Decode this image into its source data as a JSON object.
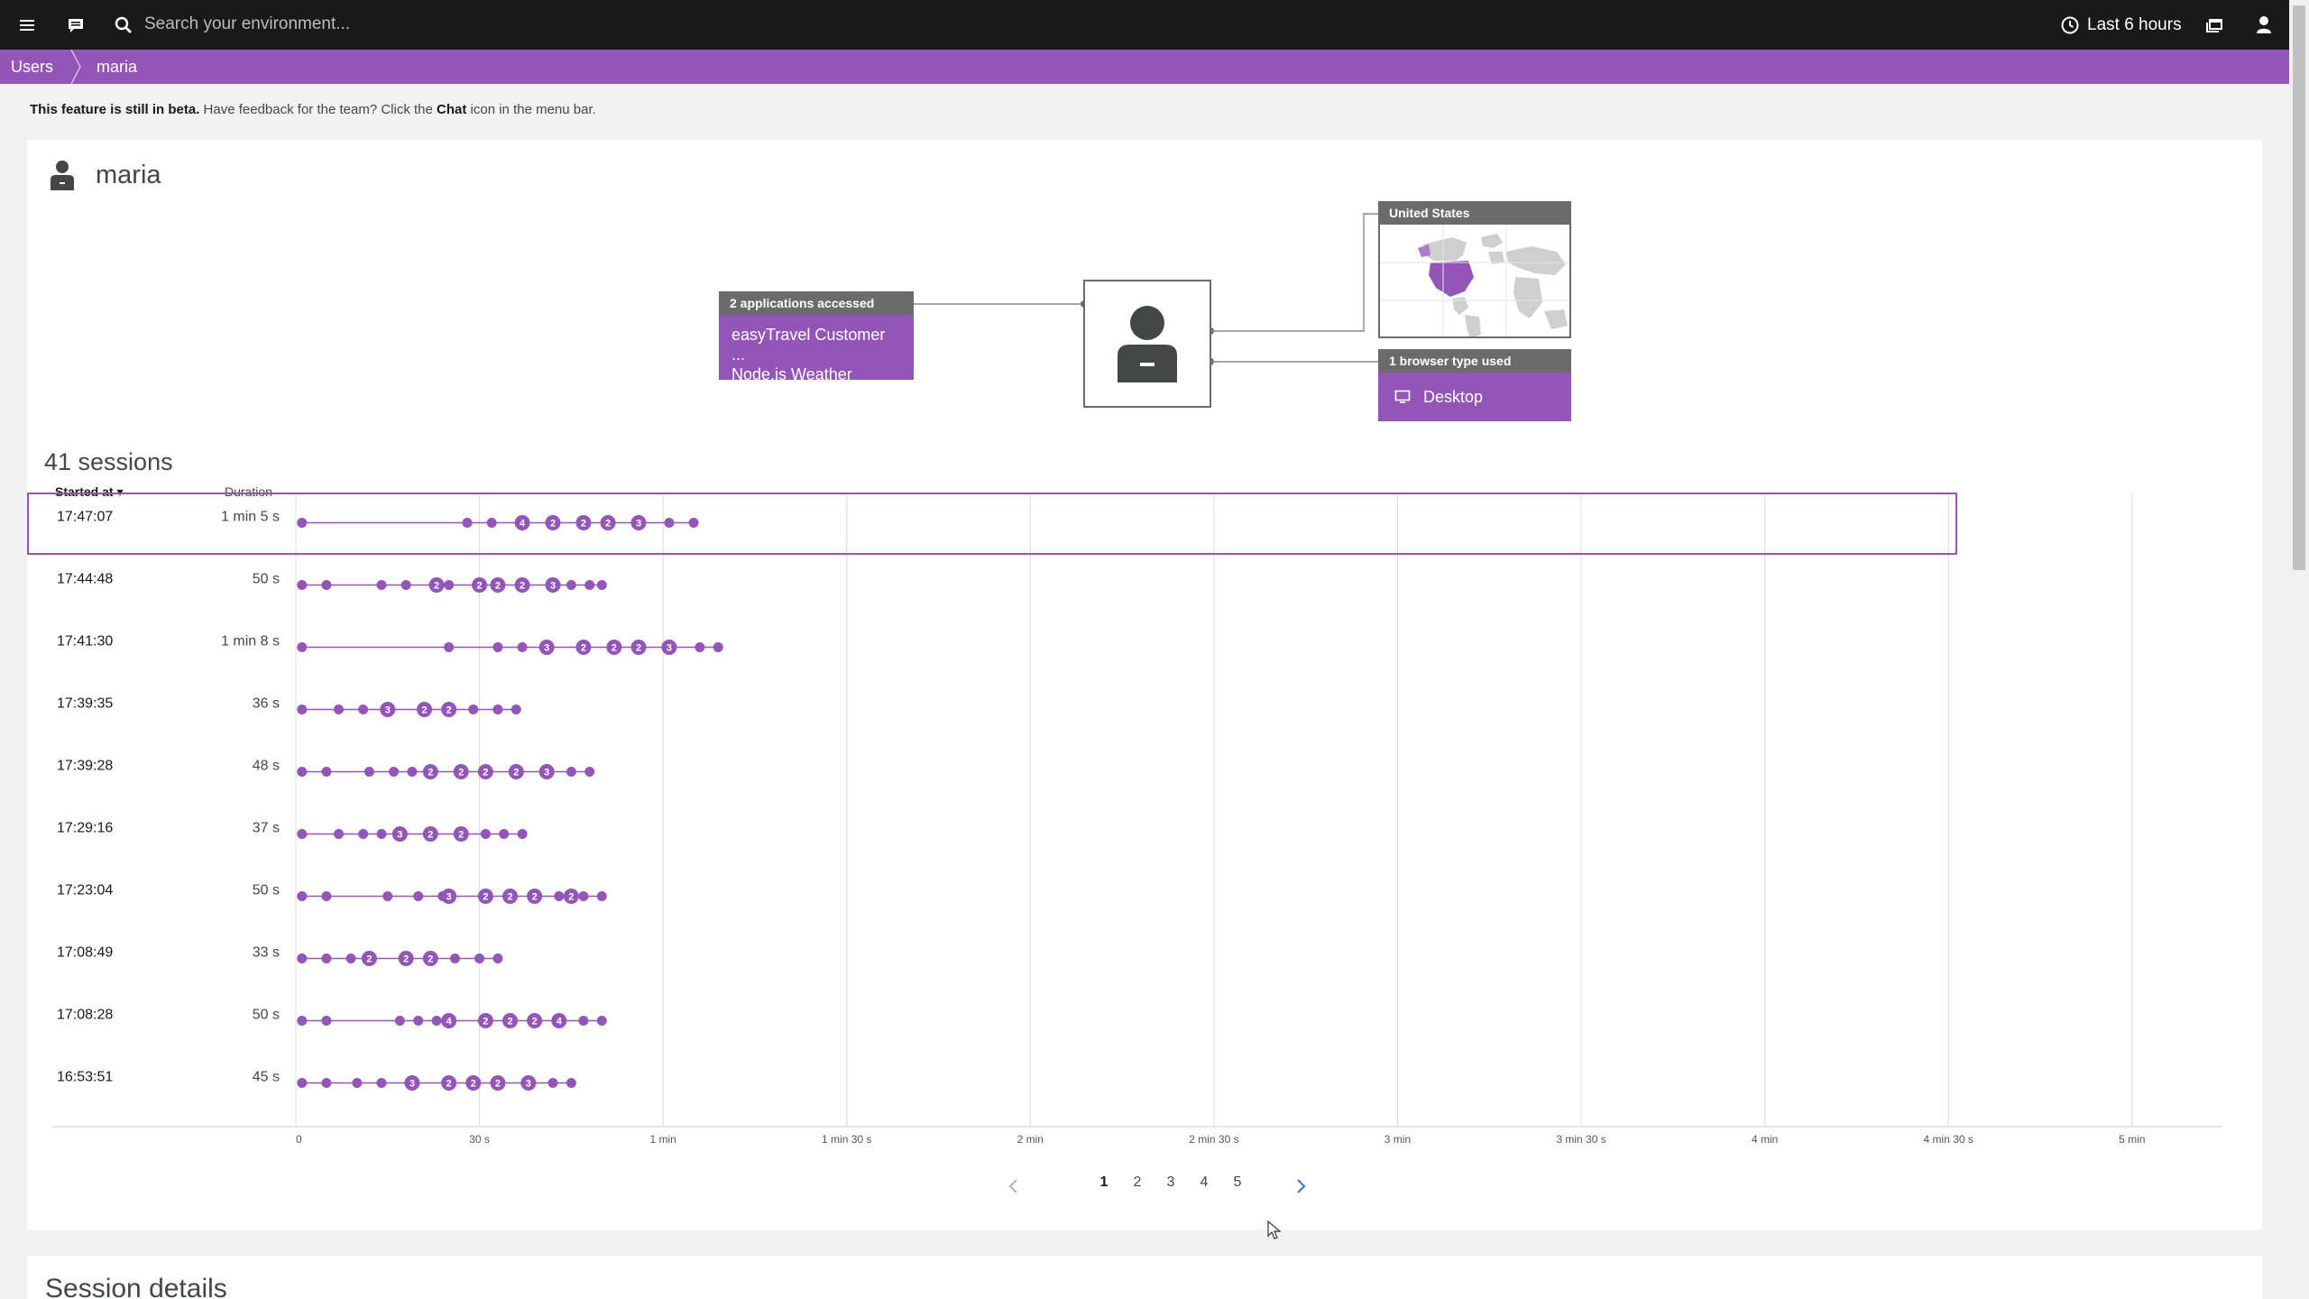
{
  "topbar": {
    "search_placeholder": "Search your environment...",
    "timeframe_label": "Last 6 hours",
    "icons": [
      "menu-icon",
      "chat-icon",
      "search-icon",
      "clock-icon",
      "window-icon",
      "user-icon"
    ]
  },
  "breadcrumb": [
    "Users",
    "maria"
  ],
  "beta_notice": {
    "bold": "This feature is still in beta.",
    "middle": " Have feedback for the team? Click the ",
    "chat_word": "Chat",
    "end": " icon in the menu bar."
  },
  "user": {
    "name": "maria"
  },
  "overview": {
    "apps_heading": "2 applications accessed",
    "apps": [
      "easyTravel Customer ...",
      "Node.js Weather"
    ],
    "country_heading": "United States",
    "browser_heading": "1 browser type used",
    "browser": "Desktop"
  },
  "sessions": {
    "title": "41 sessions",
    "col_started": "Started at ▾",
    "col_duration": "Duration",
    "axis_ticks": [
      "0",
      "30 s",
      "1 min",
      "1 min 30 s",
      "2 min",
      "2 min 30 s",
      "3 min",
      "3 min 30 s",
      "4 min",
      "4 min 30 s",
      "5 min"
    ],
    "rows": [
      {
        "started": "17:47:07",
        "duration": "1 min 5 s",
        "selected": true,
        "events": [
          {
            "t": 1
          },
          {
            "t": 28
          },
          {
            "t": 32
          },
          {
            "t": 37,
            "n": "4"
          },
          {
            "t": 42,
            "n": "2"
          },
          {
            "t": 47,
            "n": "2"
          },
          {
            "t": 51,
            "n": "2"
          },
          {
            "t": 56,
            "n": "3"
          },
          {
            "t": 61
          },
          {
            "t": 65
          }
        ]
      },
      {
        "started": "17:44:48",
        "duration": "50 s",
        "events": [
          {
            "t": 1
          },
          {
            "t": 5
          },
          {
            "t": 14
          },
          {
            "t": 18
          },
          {
            "t": 23,
            "n": "2"
          },
          {
            "t": 25
          },
          {
            "t": 30,
            "n": "2"
          },
          {
            "t": 33,
            "n": "2"
          },
          {
            "t": 37,
            "n": "2"
          },
          {
            "t": 42,
            "n": "3"
          },
          {
            "t": 45
          },
          {
            "t": 48
          },
          {
            "t": 50
          }
        ]
      },
      {
        "started": "17:41:30",
        "duration": "1 min 8 s",
        "events": [
          {
            "t": 1
          },
          {
            "t": 25
          },
          {
            "t": 33
          },
          {
            "t": 37
          },
          {
            "t": 41,
            "n": "3"
          },
          {
            "t": 47,
            "n": "2"
          },
          {
            "t": 52,
            "n": "2"
          },
          {
            "t": 56,
            "n": "2"
          },
          {
            "t": 61,
            "n": "3"
          },
          {
            "t": 66
          },
          {
            "t": 69
          }
        ]
      },
      {
        "started": "17:39:35",
        "duration": "36 s",
        "events": [
          {
            "t": 1
          },
          {
            "t": 7
          },
          {
            "t": 11
          },
          {
            "t": 15,
            "n": "3"
          },
          {
            "t": 21,
            "n": "2"
          },
          {
            "t": 25,
            "n": "2"
          },
          {
            "t": 29
          },
          {
            "t": 33
          },
          {
            "t": 36
          }
        ]
      },
      {
        "started": "17:39:28",
        "duration": "48 s",
        "events": [
          {
            "t": 1
          },
          {
            "t": 5
          },
          {
            "t": 12
          },
          {
            "t": 16
          },
          {
            "t": 19
          },
          {
            "t": 22,
            "n": "2"
          },
          {
            "t": 27,
            "n": "2"
          },
          {
            "t": 31,
            "n": "2"
          },
          {
            "t": 36,
            "n": "2"
          },
          {
            "t": 41,
            "n": "3"
          },
          {
            "t": 45
          },
          {
            "t": 48
          }
        ]
      },
      {
        "started": "17:29:16",
        "duration": "37 s",
        "events": [
          {
            "t": 1
          },
          {
            "t": 7
          },
          {
            "t": 11
          },
          {
            "t": 14
          },
          {
            "t": 17,
            "n": "3"
          },
          {
            "t": 22,
            "n": "2"
          },
          {
            "t": 27,
            "n": "2"
          },
          {
            "t": 31
          },
          {
            "t": 34
          },
          {
            "t": 37
          }
        ]
      },
      {
        "started": "17:23:04",
        "duration": "50 s",
        "events": [
          {
            "t": 1
          },
          {
            "t": 5
          },
          {
            "t": 15
          },
          {
            "t": 20
          },
          {
            "t": 24
          },
          {
            "t": 25,
            "n": "3"
          },
          {
            "t": 31,
            "n": "2"
          },
          {
            "t": 35,
            "n": "2"
          },
          {
            "t": 39,
            "n": "2"
          },
          {
            "t": 43
          },
          {
            "t": 45,
            "n": "2"
          },
          {
            "t": 47
          },
          {
            "t": 50
          }
        ]
      },
      {
        "started": "17:08:49",
        "duration": "33 s",
        "events": [
          {
            "t": 1
          },
          {
            "t": 5
          },
          {
            "t": 9
          },
          {
            "t": 12,
            "n": "2"
          },
          {
            "t": 18,
            "n": "2"
          },
          {
            "t": 22,
            "n": "2"
          },
          {
            "t": 26
          },
          {
            "t": 30
          },
          {
            "t": 33
          }
        ]
      },
      {
        "started": "17:08:28",
        "duration": "50 s",
        "events": [
          {
            "t": 1
          },
          {
            "t": 5
          },
          {
            "t": 17
          },
          {
            "t": 20
          },
          {
            "t": 23
          },
          {
            "t": 25,
            "n": "4"
          },
          {
            "t": 31,
            "n": "2"
          },
          {
            "t": 35,
            "n": "2"
          },
          {
            "t": 39,
            "n": "2"
          },
          {
            "t": 43,
            "n": "4"
          },
          {
            "t": 47
          },
          {
            "t": 50
          }
        ]
      },
      {
        "started": "16:53:51",
        "duration": "45 s",
        "events": [
          {
            "t": 1
          },
          {
            "t": 5
          },
          {
            "t": 10
          },
          {
            "t": 14
          },
          {
            "t": 19,
            "n": "3"
          },
          {
            "t": 25,
            "n": "2"
          },
          {
            "t": 29,
            "n": "2"
          },
          {
            "t": 33,
            "n": "2"
          },
          {
            "t": 38,
            "n": "3"
          },
          {
            "t": 42
          },
          {
            "t": 45
          }
        ]
      }
    ]
  },
  "pagination": {
    "pages": [
      "1",
      "2",
      "3",
      "4",
      "5"
    ],
    "current": "1"
  },
  "session_details": {
    "title": "Session details"
  },
  "colors": {
    "accent": "#9355b7",
    "topbar": "#191919",
    "box_head": "#6b6b6b",
    "text": "#454646"
  }
}
